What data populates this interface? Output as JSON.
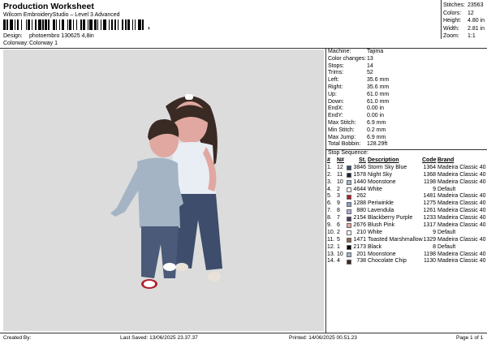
{
  "header": {
    "title": "Production Worksheet",
    "subtitle": "Wilcom EmbroideryStudio – Level 3 Advanced",
    "barcode_suffix": ","
  },
  "design_info": {
    "design_label": "Design:",
    "design_value": "photoembro 130625 4,8in",
    "colorway_label": "Colorway:",
    "colorway_value": "Colorway 1"
  },
  "stats": [
    {
      "label": "Stitches:",
      "value": "23563"
    },
    {
      "label": "Colors:",
      "value": "12"
    },
    {
      "label": "Height:",
      "value": "4.80 in"
    },
    {
      "label": "Width:",
      "value": "2.81 in"
    },
    {
      "label": "Zoom:",
      "value": "1:1"
    }
  ],
  "machine_props": [
    {
      "label": "Machine:",
      "value": "Tajima"
    },
    {
      "label": "Color changes:",
      "value": "13"
    },
    {
      "label": "Stops:",
      "value": "14"
    },
    {
      "label": "Trims:",
      "value": "52"
    },
    {
      "label": "Left:",
      "value": "35.6 mm"
    },
    {
      "label": "Right:",
      "value": "35.6 mm"
    },
    {
      "label": "Up:",
      "value": "61.0 mm"
    },
    {
      "label": "Down:",
      "value": "61.0 mm"
    },
    {
      "label": "EndX:",
      "value": "0.00 in"
    },
    {
      "label": "EndY:",
      "value": "0.00 in"
    },
    {
      "label": "Max Stitch:",
      "value": "6.9 mm"
    },
    {
      "label": "Min Stitch:",
      "value": "0.2 mm"
    },
    {
      "label": "Max Jump:",
      "value": "6.9 mm"
    },
    {
      "label": "Total Bobbin:",
      "value": "128.29ft"
    }
  ],
  "stop_sequence": {
    "title": "Stop Sequence:",
    "headers": {
      "hash": "#",
      "n": "N#",
      "st": "St.",
      "desc": "Description",
      "code": "Code",
      "brand": "Brand"
    },
    "rows": [
      {
        "hash": "1.",
        "n": "12",
        "color": "#3d4d6b",
        "st": "3846",
        "desc": "Storm Sky Blue",
        "code": "1364",
        "brand": "Madeira Classic 40"
      },
      {
        "hash": "2.",
        "n": "11",
        "color": "#1d2330",
        "st": "1578",
        "desc": "Night Sky",
        "code": "1368",
        "brand": "Madeira Classic 40"
      },
      {
        "hash": "3.",
        "n": "10",
        "color": "#a4b4c4",
        "st": "1440",
        "desc": "Moonstone",
        "code": "1198",
        "brand": "Madeira Classic 40"
      },
      {
        "hash": "4.",
        "n": "2",
        "color": "#ffffff",
        "st": "4644",
        "desc": "White",
        "code": "9",
        "brand": "Default"
      },
      {
        "hash": "5.",
        "n": "3",
        "color": "#b02030",
        "st": "262",
        "desc": "",
        "code": "1481",
        "brand": "Madeira Classic 40"
      },
      {
        "hash": "6.",
        "n": "9",
        "color": "#8ea0c4",
        "st": "1288",
        "desc": "Periwinkle",
        "code": "1275",
        "brand": "Madeira Classic 40"
      },
      {
        "hash": "7.",
        "n": "8",
        "color": "#b8a8d8",
        "st": "880",
        "desc": "Lavendula",
        "code": "1261",
        "brand": "Madeira Classic 40"
      },
      {
        "hash": "8.",
        "n": "7",
        "color": "#4a3a5a",
        "st": "2154",
        "desc": "Blackberry Purple",
        "code": "1233",
        "brand": "Madeira Classic 40"
      },
      {
        "hash": "9.",
        "n": "6",
        "color": "#e0a8a0",
        "st": "2676",
        "desc": "Blush Pink",
        "code": "1317",
        "brand": "Madeira Classic 40"
      },
      {
        "hash": "10.",
        "n": "2",
        "color": "#ffffff",
        "st": "210",
        "desc": "White",
        "code": "9",
        "brand": "Default"
      },
      {
        "hash": "11.",
        "n": "5",
        "color": "#8a6a58",
        "st": "1471",
        "desc": "Toasted Marshmallow",
        "code": "1329",
        "brand": "Madeira Classic 40"
      },
      {
        "hash": "12.",
        "n": "1",
        "color": "#000000",
        "st": "2173",
        "desc": "Black",
        "code": "8",
        "brand": "Default"
      },
      {
        "hash": "13.",
        "n": "10",
        "color": "#a4b4c4",
        "st": "201",
        "desc": "Moonstone",
        "code": "1198",
        "brand": "Madeira Classic 40"
      },
      {
        "hash": "14.",
        "n": "4",
        "color": "#3a2a24",
        "st": "738",
        "desc": "Chocolate Chip",
        "code": "1130",
        "brand": "Madeira Classic 40"
      }
    ]
  },
  "footer": {
    "created_by": "Created By:",
    "last_saved": "Last Saved: 13/06/2025 23.37.37",
    "printed": "Printed: 14/06/2025 00.51.23",
    "page": "Page 1 of 1"
  }
}
